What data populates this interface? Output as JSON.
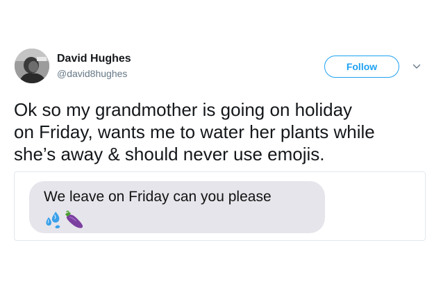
{
  "tweet": {
    "author": {
      "display_name": "David Hughes",
      "handle": "@david8hughes",
      "avatar_icon": "profile-photo"
    },
    "follow_label": "Follow",
    "menu_icon": "chevron-down-icon",
    "text": "Ok so my grandmother is going on holiday\non Friday, wants me to water her plants while\nshe’s away & should never use emojis.",
    "attached_message": {
      "text": "We leave on Friday can you please",
      "emojis": [
        "sweat-droplets-emoji",
        "eggplant-emoji"
      ]
    }
  },
  "colors": {
    "accent": "#1da1f2",
    "text_primary": "#14171a",
    "text_secondary": "#657786",
    "bubble_bg": "#e6e5eb"
  }
}
